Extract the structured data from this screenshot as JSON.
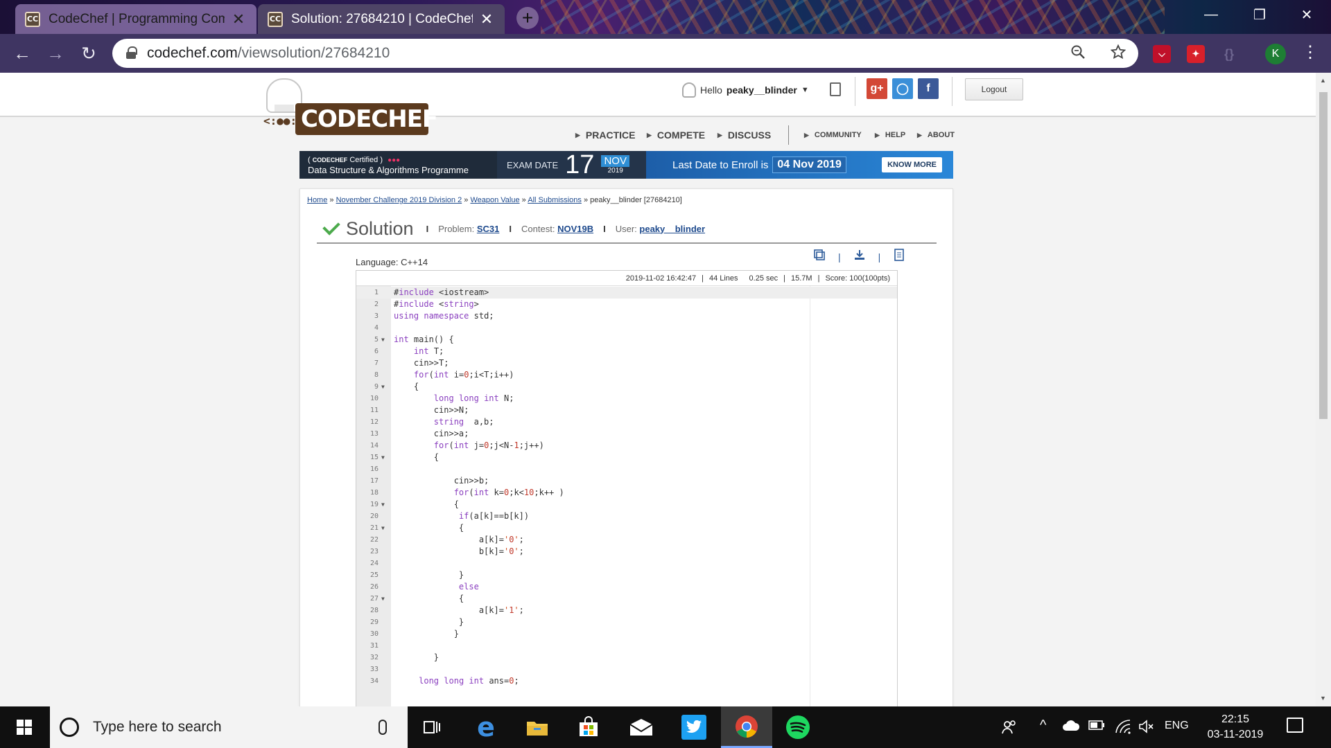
{
  "browser": {
    "tabs": [
      {
        "favicon": "CC",
        "title": "CodeChef | Programming Comp",
        "close": "✕"
      },
      {
        "favicon": "CC",
        "title": "Solution: 27684210 | CodeChef",
        "close": "✕"
      }
    ],
    "new_tab": "+",
    "window_controls": {
      "minimize": "—",
      "maximize": "❐",
      "close": "✕"
    },
    "nav": {
      "back": "←",
      "forward": "→",
      "reload": "↻"
    },
    "url_host": "codechef.com",
    "url_path": "/viewsolution/27684210",
    "zoom_icon": "zoom-icon",
    "star_icon": "bookmark-star-icon",
    "profile_initial": "K",
    "menu": "⋮"
  },
  "site": {
    "logo_text": "CODECHEF",
    "logo_face": "<:●●:>",
    "greeting": "Hello",
    "username": "peaky__blinder",
    "logout": "Logout",
    "social": [
      {
        "name": "google-plus",
        "label": "g+",
        "color": "#d34836"
      },
      {
        "name": "github",
        "label": "◯",
        "color": "#3b8fd8"
      },
      {
        "name": "facebook",
        "label": "f",
        "color": "#3b5998"
      }
    ],
    "nav_main": [
      "PRACTICE",
      "COMPETE",
      "DISCUSS"
    ],
    "nav_small": [
      "COMMUNITY",
      "HELP",
      "ABOUT"
    ],
    "banner": {
      "brand": "CODECHEF",
      "certified": "Certified",
      "program": "Data Structure & Algorithms Programme",
      "exam_label": "EXAM DATE",
      "exam_day": "17",
      "exam_month": "NOV",
      "exam_year": "2019",
      "enroll_text": "Last Date to Enroll is",
      "enroll_date": "04 Nov 2019",
      "cta": "KNOW MORE"
    }
  },
  "breadcrumb": {
    "items": [
      "Home",
      "November Challenge 2019 Division 2",
      "Weapon Value",
      "All Submissions"
    ],
    "separator": "»",
    "current": "peaky__blinder [27684210]"
  },
  "solution": {
    "title": "Solution",
    "problem_label": "Problem:",
    "problem": "SC31",
    "contest_label": "Contest:",
    "contest": "NOV19B",
    "user_label": "User:",
    "user": "peaky__blinder",
    "language": "Language: C++14",
    "status": {
      "datetime": "2019-11-02 16:42:47",
      "lines": "44 Lines",
      "time": "0.25 sec",
      "memory": "15.7M",
      "score": "Score: 100(100pts)"
    }
  },
  "code": [
    "#include <iostream>",
    "#include <string>",
    "using namespace std;",
    "",
    "int main() {",
    "    int T;",
    "    cin>>T;",
    "    for(int i=0;i<T;i++)",
    "    {",
    "        long long int N;",
    "        cin>>N;",
    "        string  a,b;",
    "        cin>>a;",
    "        for(int j=0;j<N-1;j++)",
    "        {",
    "",
    "            cin>>b;",
    "            for(int k=0;k<10;k++ )",
    "            {",
    "             if(a[k]==b[k])",
    "             {",
    "                 a[k]='0';",
    "                 b[k]='0';",
    "",
    "             }",
    "             else",
    "             {",
    "                 a[k]='1';",
    "             }",
    "            }",
    "",
    "        }",
    "",
    "     long long int ans=0;"
  ],
  "fold_lines": [
    5,
    9,
    15,
    19,
    21,
    27
  ],
  "taskbar": {
    "search_placeholder": "Type here to search",
    "language": "ENG",
    "time": "22:15",
    "date": "03-11-2019"
  }
}
